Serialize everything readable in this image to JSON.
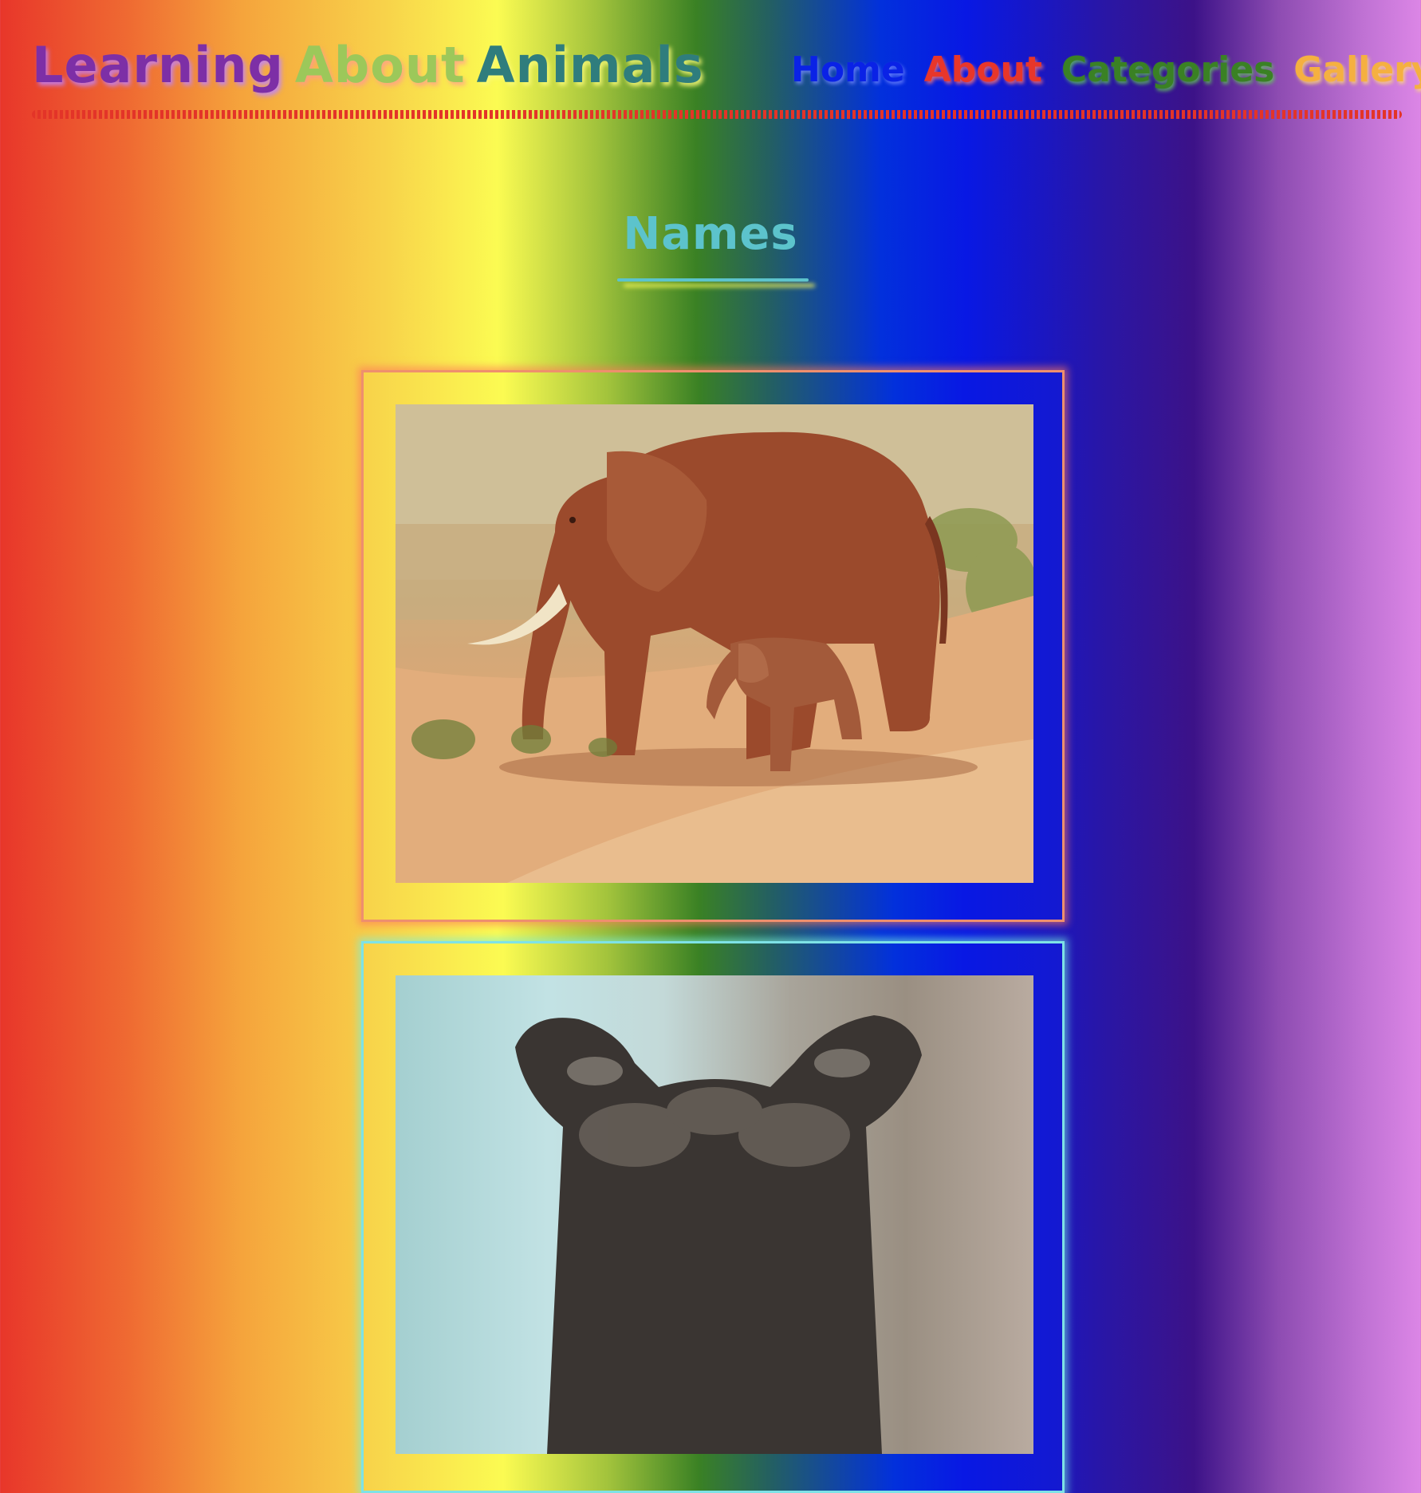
{
  "site": {
    "title_words": [
      "Learning",
      "About",
      "Animals"
    ]
  },
  "nav": {
    "items": [
      {
        "label": "Home"
      },
      {
        "label": "About"
      },
      {
        "label": "Categories"
      },
      {
        "label": "Gallery"
      }
    ]
  },
  "page": {
    "heading": "Names"
  },
  "gallery": {
    "items": [
      {
        "subject": "elephant-mother-and-calf",
        "border_color": "#ee8f6e"
      },
      {
        "subject": "owl",
        "border_color": "#7ee2e6"
      }
    ]
  },
  "colors": {
    "heading": "#5cc3cc",
    "nav_home": "#0a22e6",
    "nav_about": "#e8362a",
    "nav_categories": "#3a8124",
    "nav_gallery": "#f5b040",
    "divider": "#e33428"
  }
}
